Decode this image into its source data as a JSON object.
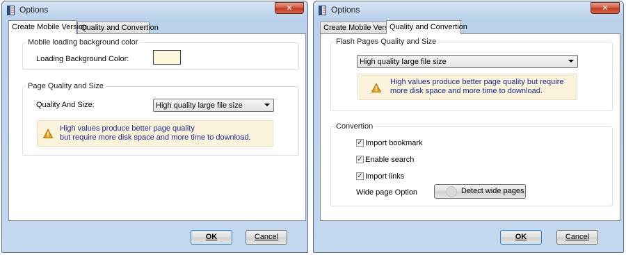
{
  "windows": [
    {
      "title": "Options",
      "close_icon": "close-icon",
      "tabs": [
        {
          "label": "Create Mobile Version",
          "active": true
        },
        {
          "label": "Quality and Convertion",
          "active": false
        }
      ],
      "mobile_bg_group": {
        "legend": "Mobile loading background color",
        "bg_color_label": "Loading Background Color:",
        "bg_color_value": "#fff8dc"
      },
      "quality_group": {
        "legend": "Page Quality and Size",
        "quality_label": "Quality And Size:",
        "quality_selected": "High quality large file size",
        "note_line1": "High values produce better page quality",
        "note_line2": "but require more disk space and more time to download."
      },
      "ok_label": "OK",
      "cancel_label": "Cancel"
    },
    {
      "title": "Options",
      "close_icon": "close-icon",
      "tabs": [
        {
          "label": "Create Mobile Version",
          "active": false
        },
        {
          "label": "Quality and Convertion",
          "active": true
        }
      ],
      "flash_group": {
        "legend": "Flash Pages Quality and Size",
        "quality_selected": "High quality large file size",
        "note_line1": "High values produce better page quality but require",
        "note_line2": "more disk space and more time to download."
      },
      "convertion_group": {
        "legend": "Convertion",
        "import_bookmark_label": "Import bookmark",
        "import_bookmark_checked": true,
        "enable_search_label": "Enable search",
        "enable_search_checked": true,
        "import_links_label": "Import links",
        "import_links_checked": true,
        "wide_page_label": "Wide page Option",
        "detect_button_label": "Detect wide pages"
      },
      "ok_label": "OK",
      "cancel_label": "Cancel"
    }
  ],
  "colors": {
    "warning_text": "#1b2b8f",
    "note_background": "#fbf3dc"
  }
}
